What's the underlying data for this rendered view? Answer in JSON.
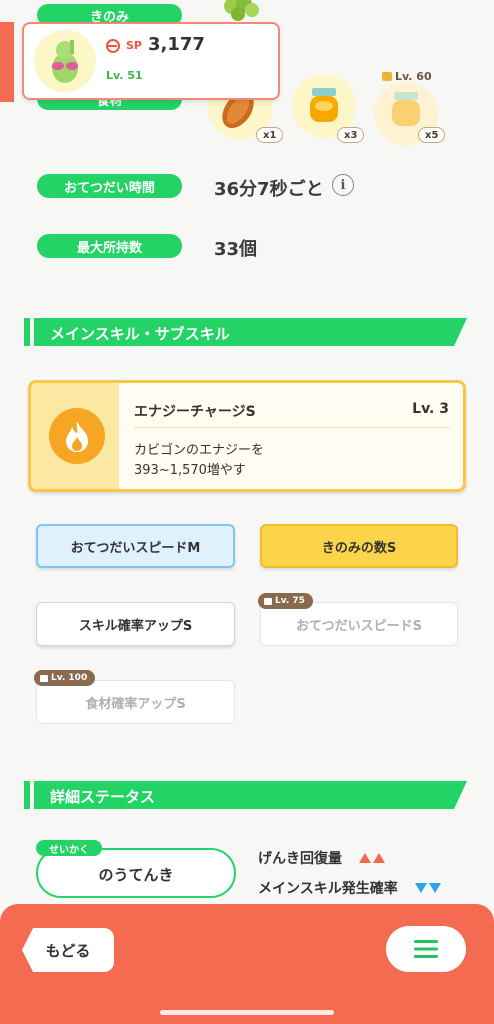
{
  "stats": {
    "berry_label": "きのみ",
    "ingredient_label": "食材",
    "help_time_label": "おてつだい時間",
    "help_time_value": "36分7秒ごと",
    "carry_label": "最大所持数",
    "carry_value": "33個"
  },
  "pokemon_card": {
    "sp_label": "SP",
    "sp_value": "3,177",
    "level": "Lv. 51"
  },
  "ingredients": [
    {
      "icon": "cacao-icon",
      "count": "x1"
    },
    {
      "icon": "honey-jar-icon",
      "count": "x3"
    },
    {
      "icon": "honey-jar-icon",
      "count": "x5",
      "lock": "Lv. 60"
    }
  ],
  "main_skill_section": {
    "title": "メインスキル・サブスキル"
  },
  "main_skill": {
    "name": "エナジーチャージS",
    "level": "Lv. 3",
    "desc1": "カビゴンのエナジーを",
    "desc2": "393~1,570増やす",
    "icon": "fire-icon"
  },
  "sub_skills": [
    {
      "label": "おてつだいスピードM",
      "color": "#dff1fd"
    },
    {
      "label": "きのみの数S",
      "color": "#fbd44a"
    },
    {
      "label": "スキル確率アップS"
    },
    {
      "label": "おてつだいスピードS",
      "lock": "Lv. 75"
    },
    {
      "label": "食材確率アップS",
      "lock": "Lv. 100"
    }
  ],
  "detail_section": {
    "title": "詳細ステータス"
  },
  "nature": {
    "tag": "せいかく",
    "value": "のうてんき",
    "up_label": "げんき回復量",
    "down_label": "メインスキル発生確率"
  },
  "footer": {
    "back_label": "もどる"
  }
}
